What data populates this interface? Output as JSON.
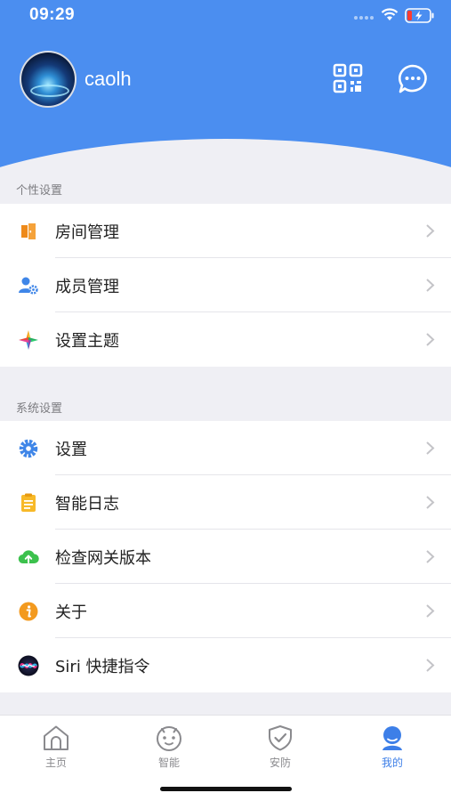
{
  "status_bar": {
    "time": "09:29"
  },
  "profile": {
    "username": "caolh"
  },
  "sections": [
    {
      "title": "个性设置",
      "items": [
        {
          "label": "房间管理",
          "icon": "door-icon"
        },
        {
          "label": "成员管理",
          "icon": "member-gear-icon"
        },
        {
          "label": "设置主题",
          "icon": "theme-star-icon"
        }
      ]
    },
    {
      "title": "系统设置",
      "items": [
        {
          "label": "设置",
          "icon": "gear-icon"
        },
        {
          "label": "智能日志",
          "icon": "clipboard-icon"
        },
        {
          "label": "检查网关版本",
          "icon": "cloud-upload-icon"
        },
        {
          "label": "关于",
          "icon": "info-icon"
        },
        {
          "label": "Siri 快捷指令",
          "icon": "siri-icon"
        }
      ]
    }
  ],
  "tabbar": {
    "tabs": [
      {
        "label": "主页",
        "icon": "home-icon",
        "active": false
      },
      {
        "label": "智能",
        "icon": "robot-face-icon",
        "active": false
      },
      {
        "label": "安防",
        "icon": "shield-check-icon",
        "active": false
      },
      {
        "label": "我的",
        "icon": "person-icon",
        "active": true
      }
    ]
  },
  "colors": {
    "header_blue": "#4b8ef0",
    "active_tab": "#3d7fe8",
    "background": "#efeff4"
  }
}
